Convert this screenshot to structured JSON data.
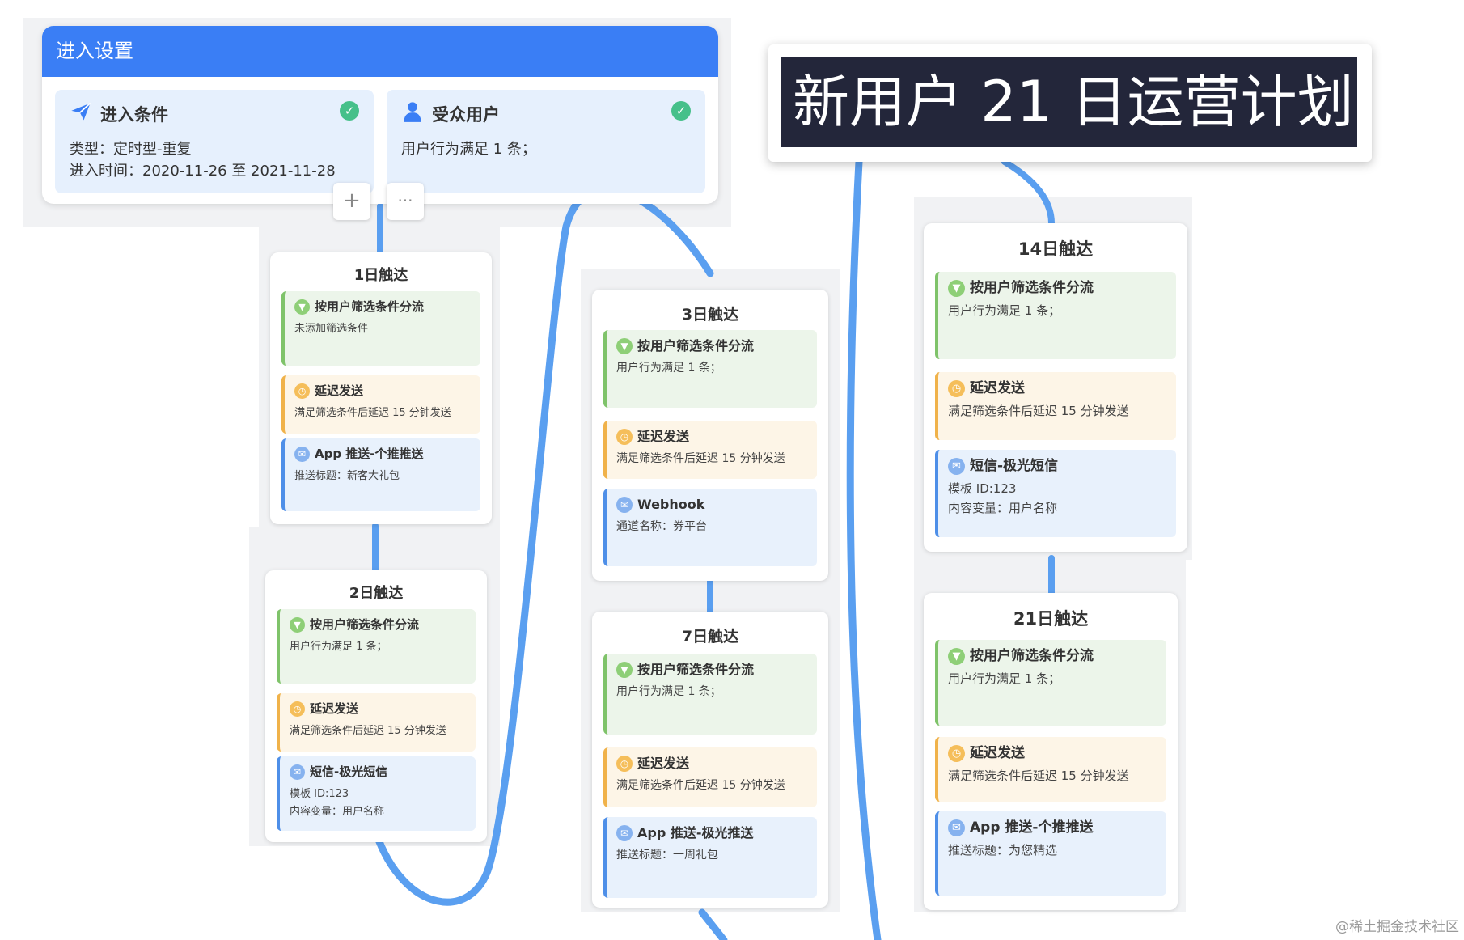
{
  "entry_settings": {
    "header": "进入设置",
    "condition_card": {
      "title": "进入条件",
      "type_line": "类型：定时型-重复",
      "time_line": "进入时间：2020-11-26 至 2021-11-28",
      "icon": "paper-plane-icon"
    },
    "audience_card": {
      "title": "受众用户",
      "desc": "用户行为满足 1 条；",
      "icon": "user-icon"
    },
    "add_button": "+",
    "more_button": "···"
  },
  "plan_title": "新用户 21 日运营计划",
  "days": [
    {
      "title": "1日触达",
      "nodes": [
        {
          "kind": "filter",
          "title": "按用户筛选条件分流",
          "lines": [
            "未添加筛选条件"
          ]
        },
        {
          "kind": "delay",
          "title": "延迟发送",
          "lines": [
            "满足筛选条件后延迟 15 分钟发送"
          ]
        },
        {
          "kind": "send",
          "title": "App 推送-个推推送",
          "lines": [
            "推送标题：新客大礼包"
          ]
        }
      ]
    },
    {
      "title": "2日触达",
      "nodes": [
        {
          "kind": "filter",
          "title": "按用户筛选条件分流",
          "lines": [
            "用户行为满足 1 条；"
          ]
        },
        {
          "kind": "delay",
          "title": "延迟发送",
          "lines": [
            "满足筛选条件后延迟 15 分钟发送"
          ]
        },
        {
          "kind": "send",
          "title": "短信-极光短信",
          "lines": [
            "模板 ID:123",
            "内容变量：用户名称"
          ]
        }
      ]
    },
    {
      "title": "3日触达",
      "nodes": [
        {
          "kind": "filter",
          "title": "按用户筛选条件分流",
          "lines": [
            "用户行为满足 1 条；"
          ]
        },
        {
          "kind": "delay",
          "title": "延迟发送",
          "lines": [
            "满足筛选条件后延迟 15 分钟发送"
          ]
        },
        {
          "kind": "send",
          "title": "Webhook",
          "lines": [
            "通道名称：券平台"
          ]
        }
      ]
    },
    {
      "title": "7日触达",
      "nodes": [
        {
          "kind": "filter",
          "title": "按用户筛选条件分流",
          "lines": [
            "用户行为满足 1 条；"
          ]
        },
        {
          "kind": "delay",
          "title": "延迟发送",
          "lines": [
            "满足筛选条件后延迟 15 分钟发送"
          ]
        },
        {
          "kind": "send",
          "title": "App 推送-极光推送",
          "lines": [
            "推送标题：一周礼包"
          ]
        }
      ]
    },
    {
      "title": "14日触达",
      "nodes": [
        {
          "kind": "filter",
          "title": "按用户筛选条件分流",
          "lines": [
            "用户行为满足 1 条；"
          ]
        },
        {
          "kind": "delay",
          "title": "延迟发送",
          "lines": [
            "满足筛选条件后延迟 15 分钟发送"
          ]
        },
        {
          "kind": "send",
          "title": "短信-极光短信",
          "lines": [
            "模板 ID:123",
            "内容变量：用户名称"
          ]
        }
      ]
    },
    {
      "title": "21日触达",
      "nodes": [
        {
          "kind": "filter",
          "title": "按用户筛选条件分流",
          "lines": [
            "用户行为满足 1 条；"
          ]
        },
        {
          "kind": "delay",
          "title": "延迟发送",
          "lines": [
            "满足筛选条件后延迟 15 分钟发送"
          ]
        },
        {
          "kind": "send",
          "title": "App 推送-个推推送",
          "lines": [
            "推送标题：为您精选"
          ]
        }
      ]
    }
  ],
  "icons": {
    "filter": "funnel-icon",
    "delay": "clock-icon",
    "send": "envelope-icon",
    "check": "check-circle-icon"
  },
  "colors": {
    "primary": "#3a7ef5",
    "wire": "#5a9ff0",
    "filter": "#7fc36a",
    "delay": "#f0b24a",
    "send": "#4e8fe8",
    "check": "#46c08a"
  },
  "credit": "@稀土掘金技术社区"
}
